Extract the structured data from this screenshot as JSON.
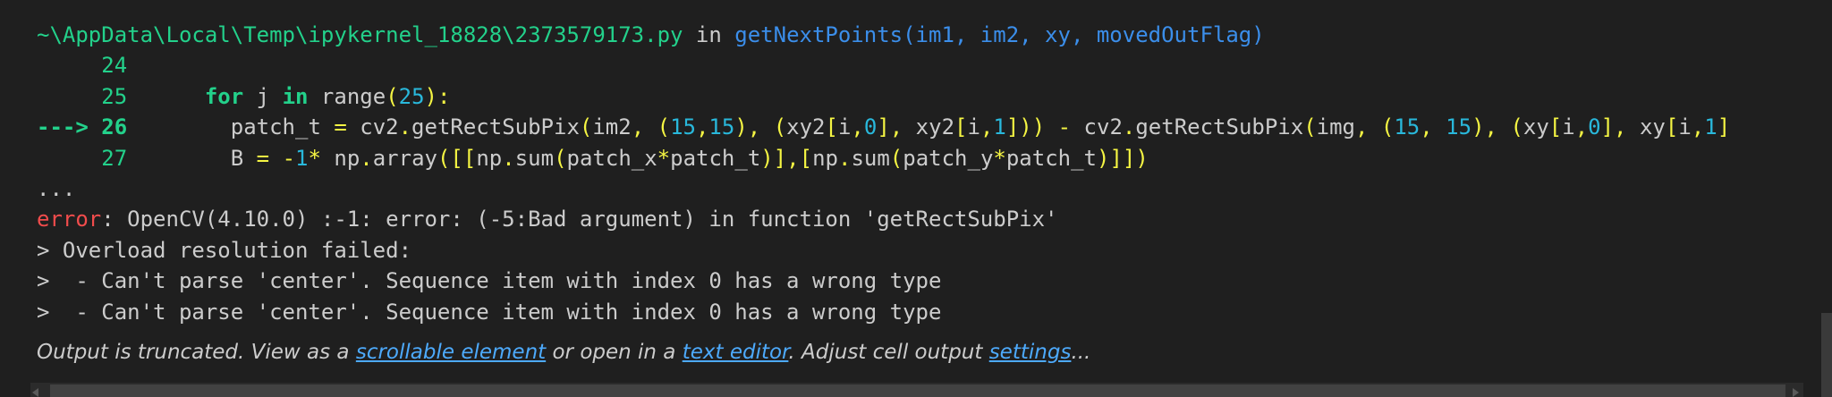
{
  "traceback": {
    "header": {
      "path": "~\\AppData\\Local\\Temp\\ipykernel_18828\\2373579173.py",
      "in_word": " in ",
      "function_sig": "getNextPoints(im1, im2, xy, movedOutFlag)"
    },
    "lines": [
      {
        "prefix": "     ",
        "number": "24"
      },
      {
        "prefix": "     ",
        "number": "25"
      },
      {
        "prefix": "---> ",
        "number": "26"
      },
      {
        "prefix": "     ",
        "number": "27"
      }
    ],
    "ellipsis": "...",
    "error_label": "error",
    "error_message": ": OpenCV(4.10.0) :-1: error: (-5:Bad argument) in function 'getRectSubPix'",
    "details": [
      "> Overload resolution failed:",
      ">  - Can't parse 'center'. Sequence item with index 0 has a wrong type",
      ">  - Can't parse 'center'. Sequence item with index 0 has a wrong type"
    ]
  },
  "footer": {
    "text_1": "Output is truncated. View as a ",
    "link_scrollable": "scrollable element",
    "text_2": " or open in a ",
    "link_editor": "text editor",
    "text_3": ". Adjust cell output ",
    "link_settings": "settings",
    "text_4": "..."
  },
  "colors": {
    "background": "#1f1f1f",
    "green": "#23d18b",
    "blue": "#3b8eea",
    "yellow": "#f5f543",
    "cyan": "#29b8db",
    "red": "#f14c4c",
    "link": "#4daafc"
  }
}
